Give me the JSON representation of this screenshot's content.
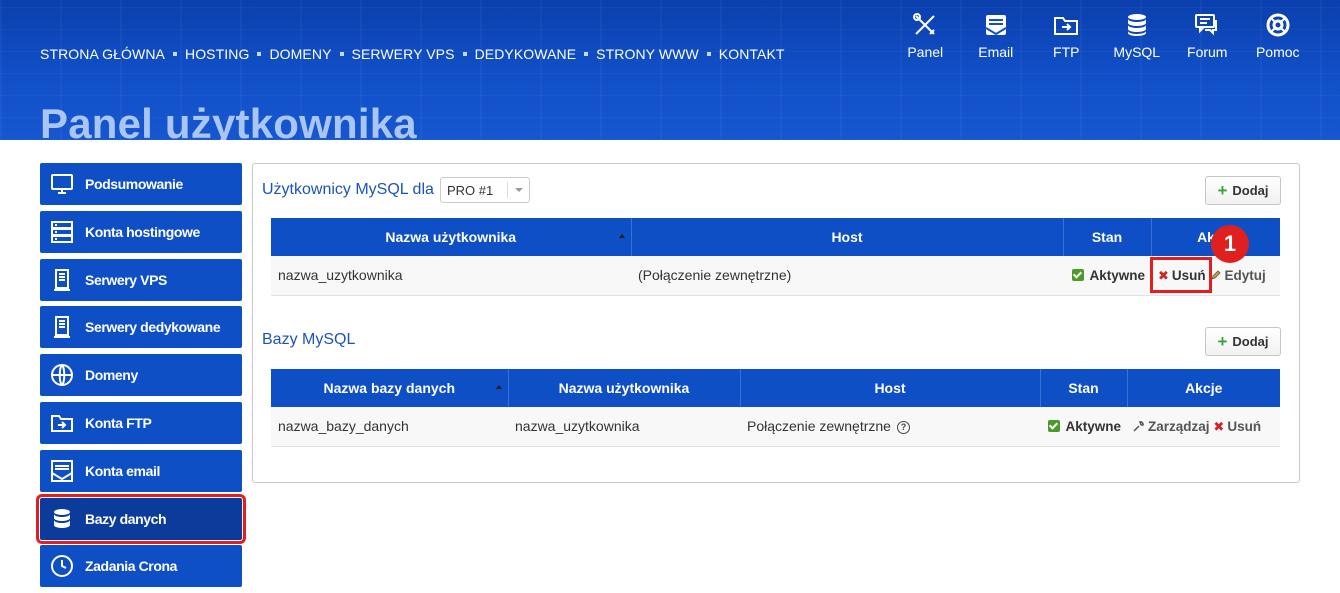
{
  "topnav": [
    "STRONA GŁÓWNA",
    "HOSTING",
    "DOMENY",
    "SERWERY VPS",
    "DEDYKOWANE",
    "STRONY WWW",
    "KONTAKT"
  ],
  "tools": [
    {
      "label": "Panel",
      "icon": "tools-icon"
    },
    {
      "label": "Email",
      "icon": "email-icon"
    },
    {
      "label": "FTP",
      "icon": "folder-icon"
    },
    {
      "label": "MySQL",
      "icon": "database-icon"
    },
    {
      "label": "Forum",
      "icon": "chat-icon"
    },
    {
      "label": "Pomoc",
      "icon": "lifebuoy-icon"
    }
  ],
  "page_title": "Panel użytkownika",
  "sidebar": {
    "items": [
      {
        "label": "Podsumowanie",
        "icon": "monitor-icon"
      },
      {
        "label": "Konta hostingowe",
        "icon": "server-stack-icon"
      },
      {
        "label": "Serwery VPS",
        "icon": "server-icon"
      },
      {
        "label": "Serwery dedykowane",
        "icon": "server-icon"
      },
      {
        "label": "Domeny",
        "icon": "globe-www-icon"
      },
      {
        "label": "Konta FTP",
        "icon": "folder-icon"
      },
      {
        "label": "Konta email",
        "icon": "envelope-icon"
      },
      {
        "label": "Bazy danych",
        "icon": "database-icon",
        "active": true
      },
      {
        "label": "Zadania Crona",
        "icon": "clock-icon"
      }
    ]
  },
  "users_section": {
    "title": "Użytkownicy MySQL dla",
    "select_value": "PRO #1",
    "add_label": "Dodaj",
    "columns": [
      "Nazwa użytkownika",
      "Host",
      "Stan",
      "Akcje"
    ],
    "rows": [
      {
        "name": "nazwa_uzytkownika",
        "host": "(Połączenie zewnętrzne)",
        "status": "Aktywne",
        "delete": "Usuń",
        "edit": "Edytuj"
      }
    ]
  },
  "db_section": {
    "title": "Bazy MySQL",
    "add_label": "Dodaj",
    "columns": [
      "Nazwa bazy danych",
      "Nazwa użytkownika",
      "Host",
      "Stan",
      "Akcje"
    ],
    "rows": [
      {
        "db": "nazwa_bazy_danych",
        "user": "nazwa_uzytkownika",
        "host": "Połączenie zewnętrzne",
        "status": "Aktywne",
        "manage": "Zarządzaj",
        "delete": "Usuń"
      }
    ]
  },
  "annotation": {
    "badge": "1"
  },
  "colors": {
    "brand": "#0f4fc6",
    "highlight": "#e0201e",
    "ok": "#4c9a2a"
  }
}
